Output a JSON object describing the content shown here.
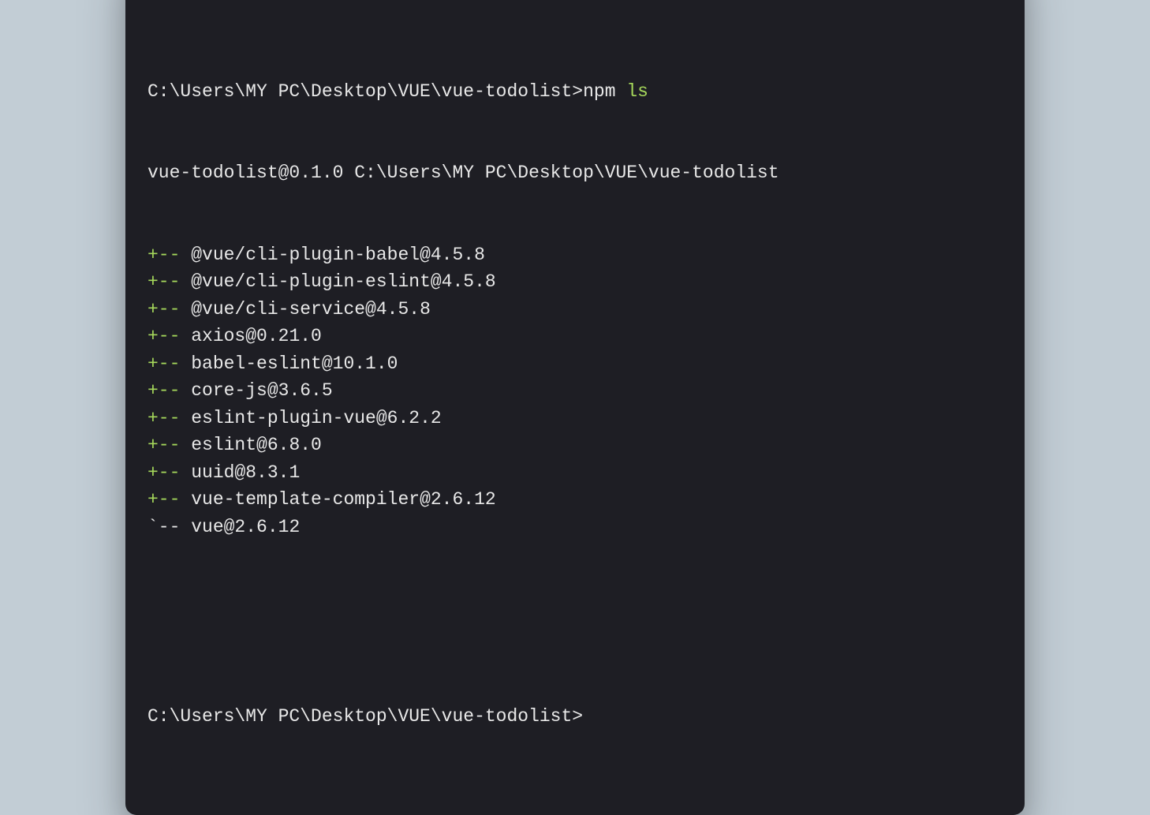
{
  "prompt": {
    "path": "C:\\Users\\MY PC\\Desktop\\VUE\\vue-todolist>",
    "command_prefix": "npm ",
    "command": "ls"
  },
  "output": {
    "header": "vue-todolist@0.1.0 C:\\Users\\MY PC\\Desktop\\VUE\\vue-todolist",
    "packages": [
      {
        "prefix": "+-- ",
        "name": "@vue/cli-plugin-babel@4.5.8",
        "last": false
      },
      {
        "prefix": "+-- ",
        "name": "@vue/cli-plugin-eslint@4.5.8",
        "last": false
      },
      {
        "prefix": "+-- ",
        "name": "@vue/cli-service@4.5.8",
        "last": false
      },
      {
        "prefix": "+-- ",
        "name": "axios@0.21.0",
        "last": false
      },
      {
        "prefix": "+-- ",
        "name": "babel-eslint@10.1.0",
        "last": false
      },
      {
        "prefix": "+-- ",
        "name": "core-js@3.6.5",
        "last": false
      },
      {
        "prefix": "+-- ",
        "name": "eslint-plugin-vue@6.2.2",
        "last": false
      },
      {
        "prefix": "+-- ",
        "name": "eslint@6.8.0",
        "last": false
      },
      {
        "prefix": "+-- ",
        "name": "uuid@8.3.1",
        "last": false
      },
      {
        "prefix": "+-- ",
        "name": "vue-template-compiler@2.6.12",
        "last": false
      },
      {
        "prefix": "`-- ",
        "name": "vue@2.6.12",
        "last": true
      }
    ]
  },
  "prompt2": {
    "path": "C:\\Users\\MY PC\\Desktop\\VUE\\vue-todolist>"
  }
}
